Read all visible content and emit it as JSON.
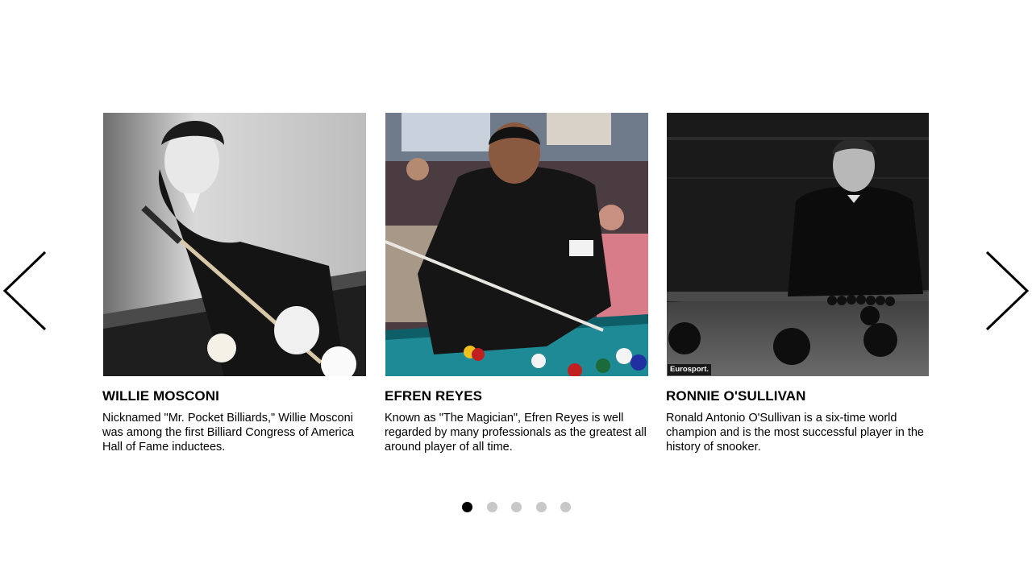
{
  "carousel": {
    "prev_icon": "chevron-left-icon",
    "next_icon": "chevron-right-icon",
    "slides": [
      {
        "title": "WILLIE MOSCONI",
        "description": "Nicknamed \"Mr. Pocket Billiards,\" Willie Mosconi was among the first Billiard Congress of America Hall of Fame inductees."
      },
      {
        "title": "EFREN REYES",
        "description": "Known as \"The Magician\", Efren Reyes is well regarded by many professionals as the greatest all around player of all time."
      },
      {
        "title": "RONNIE O'SULLIVAN",
        "description": "Ronald Antonio O'Sullivan is a six-time world champion and is the most successful player in the history of snooker.",
        "photo_watermark": "Eurosport."
      }
    ],
    "pagination": {
      "total": 5,
      "active_index": 0,
      "active_color": "#000000",
      "inactive_color": "#c8c8c8"
    }
  }
}
